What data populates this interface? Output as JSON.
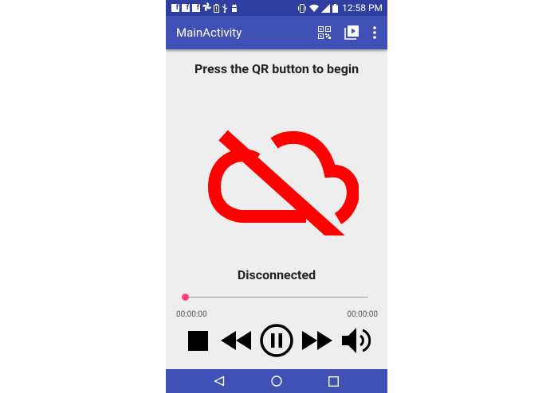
{
  "status_bar": {
    "notification_icons": [
      "facebook-icon",
      "facebook-icon",
      "facebook-icon",
      "pinwheel-icon",
      "battery-alert-icon",
      "usb-icon",
      "android-debug-icon"
    ],
    "system_icons": [
      "vibrate-icon",
      "wifi-icon",
      "signal-icon",
      "battery-icon"
    ],
    "time": "12:58 PM"
  },
  "app_bar": {
    "title": "MainActivity",
    "actions": [
      "qr-code-icon",
      "play-icon",
      "more-vert-icon"
    ]
  },
  "main": {
    "headline": "Press the QR button to begin",
    "status_icon": "cloud-off-icon",
    "status_text": "Disconnected",
    "status_color": "#ff0000"
  },
  "player": {
    "progress": 0.0,
    "elapsed": "00:00:00",
    "duration": "00:00:00",
    "accent": "#ff4081",
    "controls": [
      "stop-icon",
      "rewind-icon",
      "pause-icon",
      "fast-forward-icon",
      "volume-icon"
    ]
  },
  "nav_bar": {
    "buttons": [
      "back-icon",
      "home-icon",
      "recents-icon"
    ]
  },
  "colors": {
    "primary": "#3f51b5",
    "primary_dark": "#303f9f",
    "background": "#eeeeee"
  }
}
